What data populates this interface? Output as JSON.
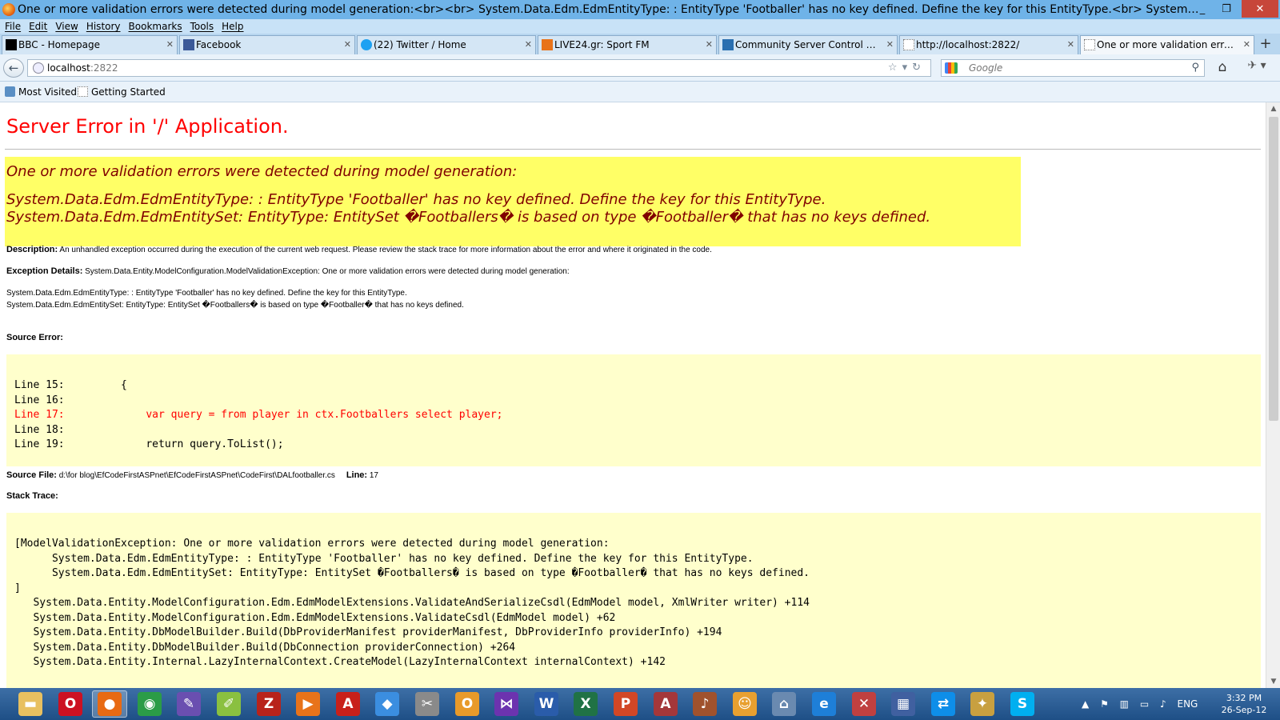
{
  "window": {
    "title": "One or more validation errors were detected during model generation:<br><br> System.Data.Edm.EdmEntityType: : EntityType 'Footballer' has no key defined. Define the key for this EntityType.<br> System.Data.Edm.EdmEnt...",
    "minimize": "_",
    "restore": "❐",
    "close": "✕"
  },
  "menu": [
    "File",
    "Edit",
    "View",
    "History",
    "Bookmarks",
    "Tools",
    "Help"
  ],
  "tabs": [
    {
      "label": "BBC - Homepage",
      "color": "#000000"
    },
    {
      "label": "Facebook",
      "color": "#3b5998"
    },
    {
      "label": "(22) Twitter / Home",
      "color": "#1da1f2"
    },
    {
      "label": "LIVE24.gr: Sport FM",
      "color": "#e8731a"
    },
    {
      "label": "Community Server Control Panel",
      "color": "#2a6fb0"
    },
    {
      "label": "http://localhost:2822/",
      "color": "#ffffff"
    },
    {
      "label": "One or more validation errors w...",
      "color": "#ffffff"
    }
  ],
  "nav": {
    "url_host": "localhost",
    "url_port": ":2822",
    "search_placeholder": "Google"
  },
  "bookmarks": [
    "Most Visited",
    "Getting Started"
  ],
  "page": {
    "title": "Server Error in '/' Application.",
    "yellow_line1": "One or more validation errors were detected during model generation:",
    "yellow_line2": "System.Data.Edm.EdmEntityType: : EntityType 'Footballer' has no key defined. Define the key for this EntityType.",
    "yellow_line3": "System.Data.Edm.EdmEntitySet: EntityType: EntitySet �Footballers� is based on type �Footballer� that has no keys defined.",
    "description_label": "Description:",
    "description_text": "An unhandled exception occurred during the execution of the current web request. Please review the stack trace for more information about the error and where it originated in the code.",
    "exception_label": "Exception Details:",
    "exception_text": "System.Data.Entity.ModelConfiguration.ModelValidationException: One or more validation errors were detected during model generation:",
    "exception_line2": "System.Data.Edm.EdmEntityType: : EntityType 'Footballer' has no key defined. Define the key for this EntityType.",
    "exception_line3": "System.Data.Edm.EdmEntitySet: EntityType: EntitySet �Footballers� is based on type �Footballer� that has no keys defined.",
    "source_error_label": "Source Error:",
    "source_lines": [
      {
        "text": "Line 15:         {",
        "highlight": false
      },
      {
        "text": "Line 16:",
        "highlight": false
      },
      {
        "text": "Line 17:             var query = from player in ctx.Footballers select player;",
        "highlight": true
      },
      {
        "text": "Line 18:",
        "highlight": false
      },
      {
        "text": "Line 19:             return query.ToList();",
        "highlight": false
      }
    ],
    "source_file_label": "Source File:",
    "source_file_path": "d:\\for blog\\EfCodeFirstASPnet\\EfCodeFirstASPnet\\CodeFirst\\DALfootballer.cs",
    "line_label": "Line:",
    "line_number": "17",
    "stack_trace_label": "Stack Trace:",
    "stack_lines": [
      "[ModelValidationException: One or more validation errors were detected during model generation:",
      "",
      "\tSystem.Data.Edm.EdmEntityType: : EntityType 'Footballer' has no key defined. Define the key for this EntityType.",
      "\tSystem.Data.Edm.EdmEntitySet: EntityType: EntitySet �Footballers� is based on type �Footballer� that has no keys defined.",
      "]",
      "   System.Data.Entity.ModelConfiguration.Edm.EdmModelExtensions.ValidateAndSerializeCsdl(EdmModel model, XmlWriter writer) +114",
      "   System.Data.Entity.ModelConfiguration.Edm.EdmModelExtensions.ValidateCsdl(EdmModel model) +62",
      "   System.Data.Entity.DbModelBuilder.Build(DbProviderManifest providerManifest, DbProviderInfo providerInfo) +194",
      "   System.Data.Entity.DbModelBuilder.Build(DbConnection providerConnection) +264",
      "   System.Data.Entity.Internal.LazyInternalContext.CreateModel(LazyInternalContext internalContext) +142"
    ]
  },
  "taskbar": {
    "apps": [
      {
        "name": "explorer-icon",
        "glyph": "▬",
        "color": "#e8c060"
      },
      {
        "name": "opera-icon",
        "glyph": "O",
        "color": "#cc1122"
      },
      {
        "name": "firefox-icon",
        "glyph": "●",
        "color": "#e86a13"
      },
      {
        "name": "chrome-icon",
        "glyph": "◉",
        "color": "#2b9c47"
      },
      {
        "name": "paint-icon",
        "glyph": "✎",
        "color": "#6a4fb0"
      },
      {
        "name": "notepad-icon",
        "glyph": "✐",
        "color": "#8ac040"
      },
      {
        "name": "filezilla-icon",
        "glyph": "Z",
        "color": "#b8231b"
      },
      {
        "name": "media-player-icon",
        "glyph": "▶",
        "color": "#e8731a"
      },
      {
        "name": "acrobat-icon",
        "glyph": "A",
        "color": "#c8201a"
      },
      {
        "name": "dropbox-icon",
        "glyph": "◆",
        "color": "#3b8ee0"
      },
      {
        "name": "tools-icon",
        "glyph": "✂",
        "color": "#8a8a8a"
      },
      {
        "name": "outlook-icon",
        "glyph": "O",
        "color": "#e89a2a"
      },
      {
        "name": "visual-studio-icon",
        "glyph": "⋈",
        "color": "#6c33af"
      },
      {
        "name": "word-icon",
        "glyph": "W",
        "color": "#2a5caa"
      },
      {
        "name": "excel-icon",
        "glyph": "X",
        "color": "#207245"
      },
      {
        "name": "powerpoint-icon",
        "glyph": "P",
        "color": "#d24726"
      },
      {
        "name": "access-icon",
        "glyph": "A",
        "color": "#a4373a"
      },
      {
        "name": "guitar-icon",
        "glyph": "♪",
        "color": "#a0522d"
      },
      {
        "name": "palette-icon",
        "glyph": "☺",
        "color": "#e8a030"
      },
      {
        "name": "network-icon",
        "glyph": "⌂",
        "color": "#6a8ab0"
      },
      {
        "name": "ie-icon",
        "glyph": "e",
        "color": "#1e7fd8"
      },
      {
        "name": "snip-icon",
        "glyph": "✕",
        "color": "#c04040"
      },
      {
        "name": "presenter-icon",
        "glyph": "▦",
        "color": "#4060a0"
      },
      {
        "name": "teamviewer-icon",
        "glyph": "⇄",
        "color": "#0e8ee9"
      },
      {
        "name": "settings-icon",
        "glyph": "✦",
        "color": "#c8a040"
      },
      {
        "name": "skype-icon",
        "glyph": "S",
        "color": "#00aff0"
      }
    ],
    "language": "ENG",
    "time": "3:32 PM",
    "date": "26-Sep-12"
  }
}
